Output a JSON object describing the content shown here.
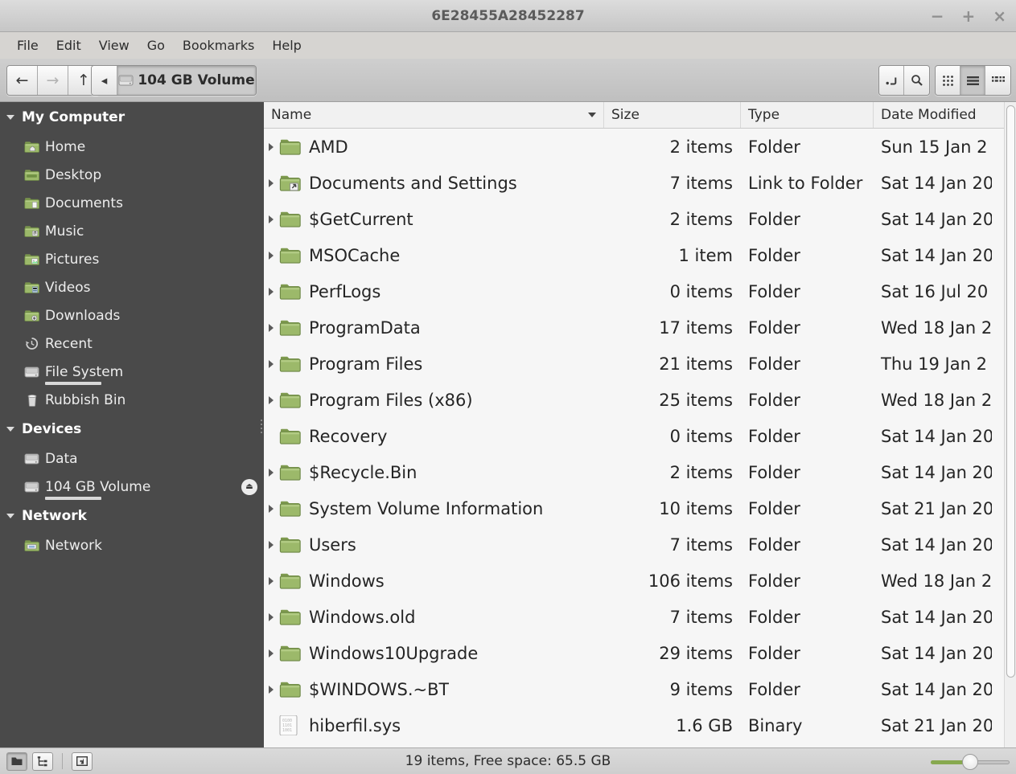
{
  "colors": {
    "accent_green": "#87a94f",
    "sidebar_bg": "#4a4a4a",
    "list_bg": "#f6f6f6"
  },
  "window": {
    "title": "6E28455A28452287",
    "controls": {
      "minimize": "−",
      "maximize": "+",
      "close": "×"
    }
  },
  "menubar": {
    "items": [
      "File",
      "Edit",
      "View",
      "Go",
      "Bookmarks",
      "Help"
    ]
  },
  "toolbar": {
    "back_glyph": "←",
    "forward_glyph": "→",
    "up_glyph": "↑",
    "path_chevron_glyph": "◂",
    "path_label": "104 GB Volume",
    "icons": [
      "location-entry",
      "search",
      "grid-view",
      "list-view",
      "compact-view"
    ],
    "active_view": "list-view"
  },
  "sidebar": {
    "sections": [
      {
        "label": "My Computer",
        "items": [
          {
            "label": "Home",
            "icon": "folder-home"
          },
          {
            "label": "Desktop",
            "icon": "folder-desktop"
          },
          {
            "label": "Documents",
            "icon": "folder-documents"
          },
          {
            "label": "Music",
            "icon": "folder-music"
          },
          {
            "label": "Pictures",
            "icon": "folder-pictures"
          },
          {
            "label": "Videos",
            "icon": "folder-videos"
          },
          {
            "label": "Downloads",
            "icon": "folder-downloads"
          },
          {
            "label": "Recent",
            "icon": "recent"
          },
          {
            "label": "File System",
            "icon": "drive",
            "usage_fraction": 0.31
          },
          {
            "label": "Rubbish Bin",
            "icon": "trash"
          }
        ]
      },
      {
        "label": "Devices",
        "items": [
          {
            "label": "Data",
            "icon": "drive"
          },
          {
            "label": "104 GB Volume",
            "icon": "drive",
            "usage_fraction": 0.38,
            "eject": true,
            "eject_glyph": "⏏"
          }
        ]
      },
      {
        "label": "Network",
        "items": [
          {
            "label": "Network",
            "icon": "network"
          }
        ]
      }
    ]
  },
  "list": {
    "columns": [
      "Name",
      "Size",
      "Type",
      "Date Modified"
    ],
    "sorted_column": "Name",
    "rows": [
      {
        "name": "AMD",
        "size": "2 items",
        "type": "Folder",
        "date": "Sun 15 Jan 2",
        "icon": "folder",
        "expander": true
      },
      {
        "name": "Documents and Settings",
        "size": "7 items",
        "type": "Link to Folder",
        "date": "Sat 14 Jan 20",
        "icon": "folder-link",
        "expander": true
      },
      {
        "name": "$GetCurrent",
        "size": "2 items",
        "type": "Folder",
        "date": "Sat 14 Jan 20",
        "icon": "folder",
        "expander": true
      },
      {
        "name": "MSOCache",
        "size": "1 item",
        "type": "Folder",
        "date": "Sat 14 Jan 20",
        "icon": "folder",
        "expander": true
      },
      {
        "name": "PerfLogs",
        "size": "0 items",
        "type": "Folder",
        "date": "Sat 16 Jul 20",
        "icon": "folder",
        "expander": true
      },
      {
        "name": "ProgramData",
        "size": "17 items",
        "type": "Folder",
        "date": "Wed 18 Jan 2",
        "icon": "folder",
        "expander": true
      },
      {
        "name": "Program Files",
        "size": "21 items",
        "type": "Folder",
        "date": "Thu 19 Jan 2",
        "icon": "folder",
        "expander": true
      },
      {
        "name": "Program Files (x86)",
        "size": "25 items",
        "type": "Folder",
        "date": "Wed 18 Jan 2",
        "icon": "folder",
        "expander": true
      },
      {
        "name": "Recovery",
        "size": "0 items",
        "type": "Folder",
        "date": "Sat 14 Jan 20",
        "icon": "folder",
        "expander": false
      },
      {
        "name": "$Recycle.Bin",
        "size": "2 items",
        "type": "Folder",
        "date": "Sat 14 Jan 20",
        "icon": "folder",
        "expander": true
      },
      {
        "name": "System Volume Information",
        "size": "10 items",
        "type": "Folder",
        "date": "Sat 21 Jan 20",
        "icon": "folder",
        "expander": true
      },
      {
        "name": "Users",
        "size": "7 items",
        "type": "Folder",
        "date": "Sat 14 Jan 20",
        "icon": "folder",
        "expander": true
      },
      {
        "name": "Windows",
        "size": "106 items",
        "type": "Folder",
        "date": "Wed 18 Jan 2",
        "icon": "folder",
        "expander": true
      },
      {
        "name": "Windows.old",
        "size": "7 items",
        "type": "Folder",
        "date": "Sat 14 Jan 20",
        "icon": "folder",
        "expander": true
      },
      {
        "name": "Windows10Upgrade",
        "size": "29 items",
        "type": "Folder",
        "date": "Sat 14 Jan 20",
        "icon": "folder",
        "expander": true
      },
      {
        "name": "$WINDOWS.~BT",
        "size": "9 items",
        "type": "Folder",
        "date": "Sat 14 Jan 20",
        "icon": "folder",
        "expander": true
      },
      {
        "name": "hiberfil.sys",
        "size": "1.6 GB",
        "type": "Binary",
        "date": "Sat 21 Jan 20",
        "icon": "binary",
        "expander": false
      }
    ]
  },
  "statusbar": {
    "text": "19 items, Free space: 65.5 GB",
    "zoom_fraction": 0.5
  }
}
